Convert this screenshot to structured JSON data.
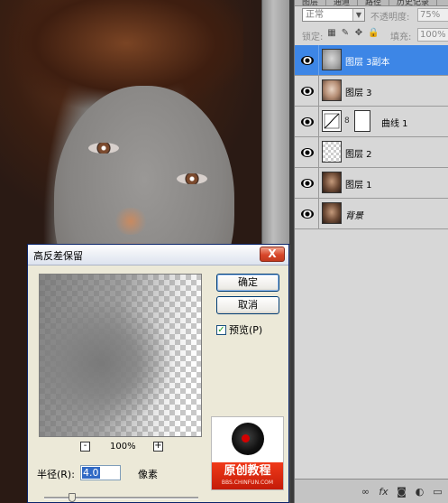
{
  "layers_panel": {
    "tabs": [
      "图层",
      "通道",
      "路径",
      "历史记录"
    ],
    "blend_mode": "正常",
    "opacity_label": "不透明度:",
    "opacity_value": "75%",
    "lock_label": "锁定:",
    "fill_label": "填充:",
    "fill_value": "100%",
    "layers": [
      {
        "name": "图层 3副本",
        "selected": true
      },
      {
        "name": "图层 3",
        "selected": false
      },
      {
        "name": "曲线 1",
        "selected": false
      },
      {
        "name": "图层 2",
        "selected": false
      },
      {
        "name": "图层 1",
        "selected": false
      },
      {
        "name": "背景",
        "selected": false
      }
    ],
    "footer_icons": [
      "link-layers-icon",
      "fx-icon",
      "mask-icon",
      "adjustment-icon",
      "group-folder-icon"
    ]
  },
  "dialog": {
    "title": "高反差保留",
    "close_label": "X",
    "ok_label": "确定",
    "cancel_label": "取消",
    "preview_label": "预览(P)",
    "preview_checked": true,
    "zoom_minus": "-",
    "zoom_plus": "+",
    "zoom_value": "100%",
    "radius_label": "半径(R):",
    "radius_value": "4.0",
    "radius_unit": "像素",
    "slider_position": 0.18
  },
  "logo": {
    "main_text": "原创教程",
    "sub_text": "BBS.CHINFUN.COM"
  }
}
